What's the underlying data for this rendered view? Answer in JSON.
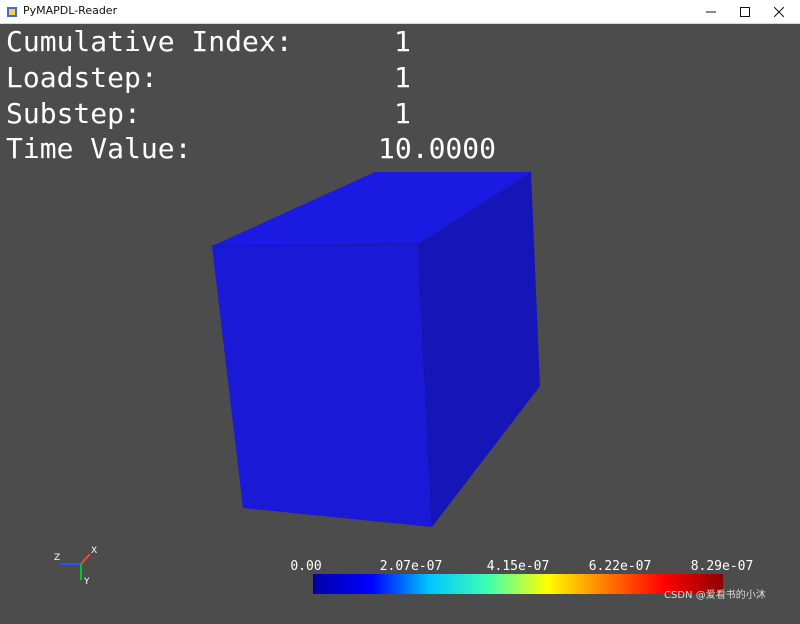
{
  "window": {
    "title": "PyMAPDL-Reader",
    "controls": {
      "minimize": "minimize",
      "maximize": "maximize",
      "close": "close"
    }
  },
  "info": [
    {
      "label": "Cumulative Index:",
      "value": "1"
    },
    {
      "label": "Loadstep:",
      "value": "1"
    },
    {
      "label": "Substep:",
      "value": "1"
    },
    {
      "label": "Time Value:",
      "value": "10.0000"
    }
  ],
  "colorbar": {
    "ticks": [
      "0.00",
      "2.07e-07",
      "4.15e-07",
      "6.22e-07",
      "8.29e-07"
    ],
    "colors": [
      "#0000a8",
      "#0000ff",
      "#00c8ff",
      "#40ffb0",
      "#ffff00",
      "#ff7a00",
      "#ff0000",
      "#8b0000"
    ]
  },
  "axes": {
    "x": "X",
    "y": "Y",
    "z": "Z",
    "colors": {
      "x": "#ff4422",
      "y": "#11bb33",
      "z": "#2255ff"
    }
  },
  "mesh": {
    "color": "#1a1ad6"
  },
  "watermark": "CSDN @爱看书的小沐"
}
